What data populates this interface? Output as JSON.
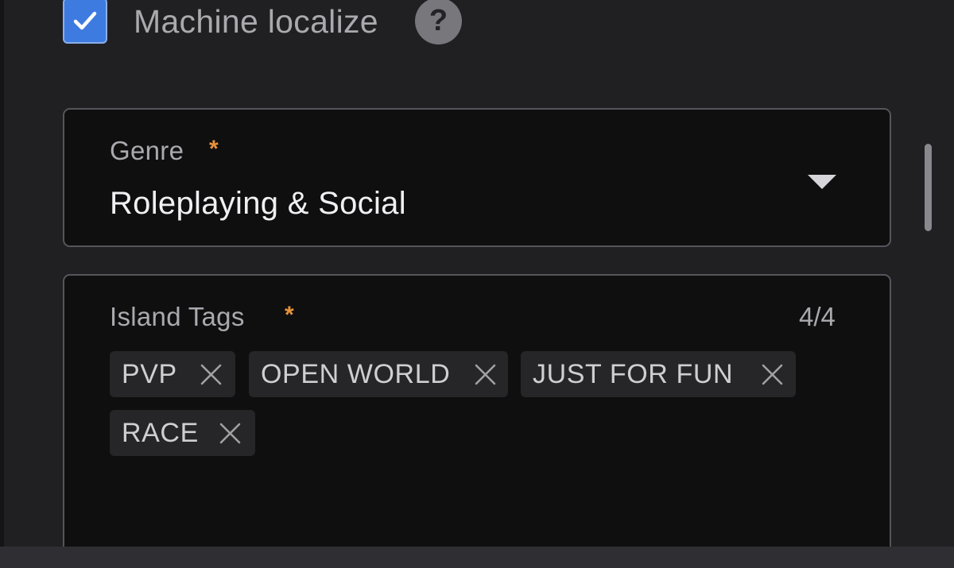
{
  "localize": {
    "label": "Machine localize",
    "checked": true,
    "help_glyph": "?"
  },
  "genre": {
    "label": "Genre",
    "required_mark": "*",
    "value": "Roleplaying & Social"
  },
  "island_tags": {
    "label": "Island Tags",
    "required_mark": "*",
    "count": "4/4",
    "tags": [
      {
        "label": "PVP"
      },
      {
        "label": "OPEN WORLD"
      },
      {
        "label": "JUST FOR FUN"
      },
      {
        "label": "RACE"
      }
    ]
  },
  "colors": {
    "checkbox_accent": "#3d7be0",
    "required_accent": "#e8923a",
    "field_background": "#0f0f10",
    "panel_background": "#202023"
  },
  "icons": {
    "checkbox": "checkmark-icon",
    "help": "question-mark-icon",
    "dropdown": "caret-down-icon",
    "tag_remove": "close-icon"
  }
}
